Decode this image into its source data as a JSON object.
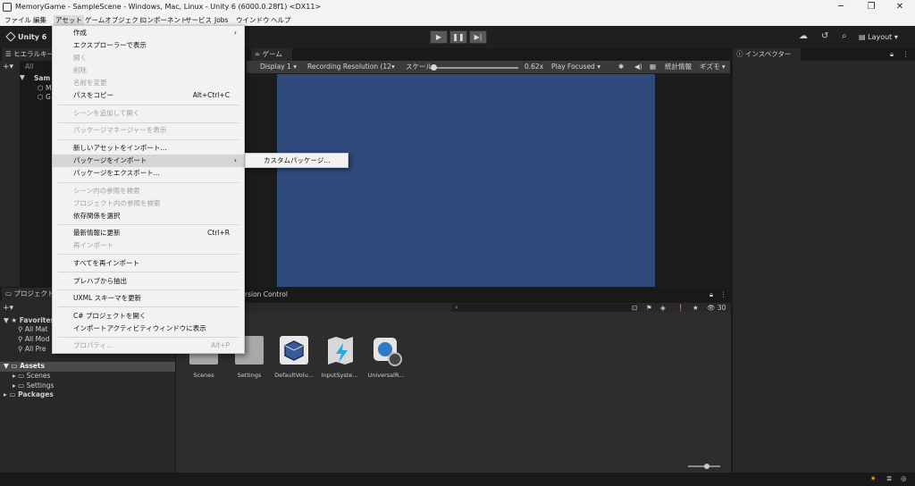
{
  "window": {
    "title": "MemoryGame - SampleScene - Windows, Mac, Linux - Unity 6 (6000.0.28f1) <DX11>",
    "minimize": "─",
    "maximize": "❐",
    "close": "✕"
  },
  "menubar": [
    "ファイル",
    "編集",
    "アセット",
    "ゲームオブジェクト",
    "コンポーネント",
    "サービス",
    "Jobs",
    "ウインドウ",
    "ヘルプ"
  ],
  "toolbar": {
    "unity_label": "Unity 6",
    "play_icon": "▶",
    "pause_icon": "❚❚",
    "step_icon": "▶|",
    "layout_label": "Layout"
  },
  "hierarchy": {
    "tab": "ヒエラルキー",
    "search_placeholder": "All",
    "scene_label": "Sam",
    "item1": "M",
    "item2": "G"
  },
  "game": {
    "tab": "ゲーム",
    "display": "Display 1",
    "resolution": "Recording Resolution (12",
    "scale_label": "スケール",
    "scale_value": "0.62x",
    "play_mode": "Play Focused",
    "stats": "統計情報",
    "gizmos": "ギズモ",
    "view_color": "#2f4b7c"
  },
  "inspector": {
    "tab": "インスペクター"
  },
  "project": {
    "tab": "プロジェクト",
    "tab2_partial": "rsion Control",
    "count": "30",
    "favorites_label": "Favorites",
    "favorites": [
      "All Mat",
      "All Mod",
      "All Pre"
    ],
    "assets_label": "Assets",
    "asset_children": [
      "Scenes",
      "Settings"
    ],
    "packages_label": "Packages",
    "assets": [
      "Scenes",
      "Settings",
      "DefaultVolu...",
      "InputSyste...",
      "UniversalR..."
    ]
  },
  "context_menu": {
    "items": [
      {
        "label": "作成",
        "arrow": "›"
      },
      {
        "label": "エクスプローラーで表示"
      },
      {
        "label": "開く",
        "disabled": true
      },
      {
        "label": "削除",
        "disabled": true
      },
      {
        "label": "名前を変更",
        "disabled": true
      },
      {
        "label": "パスをコピー",
        "shortcut": "Alt+Ctrl+C"
      },
      {
        "label": "シーンを追加して開く",
        "disabled": true
      },
      {
        "label": "パッケージマネージャーを表示",
        "disabled": true
      },
      {
        "label": "新しいアセットをインポート..."
      },
      {
        "label": "パッケージをインポート",
        "arrow": "›",
        "highlighted": true
      },
      {
        "label": "パッケージをエクスポート..."
      },
      {
        "label": "シーン内の参照を検索",
        "disabled": true
      },
      {
        "label": "プロジェクト内の参照を検索",
        "disabled": true
      },
      {
        "label": "依存関係を選択"
      },
      {
        "label": "最新情報に更新",
        "shortcut": "Ctrl+R"
      },
      {
        "label": "再インポート",
        "disabled": true
      },
      {
        "label": "すべてを再インポート"
      },
      {
        "label": "プレハブから抽出"
      },
      {
        "label": "UXML スキーマを更新"
      },
      {
        "label": "C# プロジェクトを開く"
      },
      {
        "label": "インポートアクティビティウィンドウに表示"
      },
      {
        "label": "プロパティ...",
        "shortcut": "Alt+P",
        "disabled": true
      }
    ],
    "submenu": [
      "カスタムパッケージ..."
    ]
  }
}
